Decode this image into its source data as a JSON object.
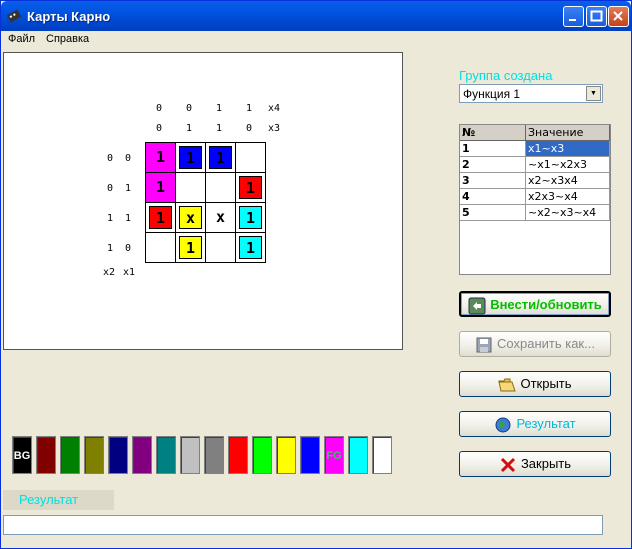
{
  "window": {
    "title": "Карты Карно"
  },
  "menu": [
    "Файл",
    "Справка"
  ],
  "kmap": {
    "top_vars": [
      "x4",
      "x3"
    ],
    "side_vars": [
      "x2",
      "x1"
    ],
    "col_x4": [
      "0",
      "0",
      "1",
      "1"
    ],
    "col_x3": [
      "0",
      "1",
      "1",
      "0"
    ],
    "row_labels": [
      "0  0",
      "0  1",
      "1  1",
      "1  0"
    ],
    "cells": [
      [
        {
          "v": "1",
          "c": "#FF00FF",
          "s": "full"
        },
        {
          "v": "1",
          "c": "#0000FF",
          "s": "box"
        },
        {
          "v": "1",
          "c": "#0000FF",
          "s": "box"
        },
        {
          "v": "",
          "c": "",
          "s": ""
        }
      ],
      [
        {
          "v": "1",
          "c": "#FF00FF",
          "s": "full"
        },
        {
          "v": "",
          "c": "",
          "s": ""
        },
        {
          "v": "",
          "c": "",
          "s": ""
        },
        {
          "v": "1",
          "c": "#FF0000",
          "s": "box"
        }
      ],
      [
        {
          "v": "1",
          "c": "#FF0000",
          "s": "box"
        },
        {
          "v": "x",
          "c": "#FFFF00",
          "s": "box"
        },
        {
          "v": "x",
          "c": "",
          "s": "plain"
        },
        {
          "v": "1",
          "c": "#00FFFF",
          "s": "box"
        }
      ],
      [
        {
          "v": "",
          "c": "",
          "s": ""
        },
        {
          "v": "1",
          "c": "#FFFF00",
          "s": "box"
        },
        {
          "v": "",
          "c": "",
          "s": ""
        },
        {
          "v": "1",
          "c": "#00FFFF",
          "s": "box"
        }
      ]
    ]
  },
  "group": {
    "title": "Группа создана",
    "combo_value": "Функция 1"
  },
  "table": {
    "headers": [
      "№",
      "Значение"
    ],
    "rows": [
      {
        "n": "1",
        "v": "x1~x3"
      },
      {
        "n": "2",
        "v": "~x1~x2x3"
      },
      {
        "n": "3",
        "v": "x2~x3x4"
      },
      {
        "n": "4",
        "v": "x2x3~x4"
      },
      {
        "n": "5",
        "v": "~x2~x3~x4"
      }
    ]
  },
  "buttons": {
    "apply": "Внести/обновить",
    "save": "Сохранить как...",
    "open": "Открыть",
    "result": "Результат",
    "close": "Закрыть"
  },
  "palette": [
    {
      "color": "#000000",
      "label": "BG"
    },
    {
      "color": "#800000",
      "label": ""
    },
    {
      "color": "#008000",
      "label": ""
    },
    {
      "color": "#808000",
      "label": ""
    },
    {
      "color": "#000080",
      "label": ""
    },
    {
      "color": "#800080",
      "label": ""
    },
    {
      "color": "#008080",
      "label": ""
    },
    {
      "color": "#C0C0C0",
      "label": ""
    },
    {
      "color": "#808080",
      "label": ""
    },
    {
      "color": "#FF0000",
      "label": ""
    },
    {
      "color": "#00FF00",
      "label": ""
    },
    {
      "color": "#FFFF00",
      "label": ""
    },
    {
      "color": "#0000FF",
      "label": ""
    },
    {
      "color": "#FF00FF",
      "label": "FG"
    },
    {
      "color": "#00FFFF",
      "label": ""
    },
    {
      "color": "#FFFFFF",
      "label": ""
    }
  ],
  "result": {
    "label": "Результат",
    "value": ""
  },
  "colors": {
    "title_blue": "#0054E3",
    "accent_cyan": "#00E0E0",
    "selection": "#316AC5"
  }
}
